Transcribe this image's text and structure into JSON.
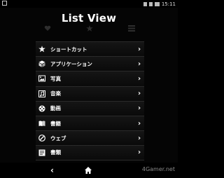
{
  "status": {
    "time": "15:11"
  },
  "title": "List View",
  "tabs": [
    {
      "icon": "heart-check-icon",
      "label": ""
    },
    {
      "icon": "star-icon",
      "label": ""
    },
    {
      "icon": "list-grid-icon",
      "label": ""
    }
  ],
  "list": {
    "items": [
      {
        "label": "ショートカット",
        "icon": "star-icon"
      },
      {
        "label": "アプリケーション",
        "icon": "cube-icon"
      },
      {
        "label": "写真",
        "icon": "photo-icon"
      },
      {
        "label": "音楽",
        "icon": "music-note-icon"
      },
      {
        "label": "動画",
        "icon": "film-reel-icon"
      },
      {
        "label": "書籍",
        "icon": "book-icon"
      },
      {
        "label": "ウェブ",
        "icon": "globe-icon"
      },
      {
        "label": "書類",
        "icon": "document-icon"
      }
    ]
  },
  "watermark": "4Gamer.net"
}
